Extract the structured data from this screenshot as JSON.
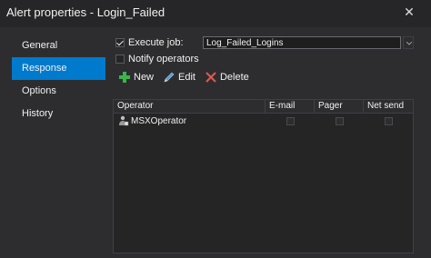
{
  "window": {
    "title": "Alert properties - Login_Failed",
    "close_glyph": "✕"
  },
  "nav": {
    "items": [
      {
        "label": "General",
        "active": false
      },
      {
        "label": "Response",
        "active": true
      },
      {
        "label": "Options",
        "active": false
      },
      {
        "label": "History",
        "active": false
      }
    ]
  },
  "response": {
    "execute_job_label": "Execute job:",
    "execute_job_checked": true,
    "job_value": "Log_Failed_Logins",
    "notify_operators_label": "Notify operators",
    "notify_operators_checked": false
  },
  "toolbar": {
    "new_label": "New",
    "edit_label": "Edit",
    "delete_label": "Delete"
  },
  "grid": {
    "columns": [
      "Operator",
      "E-mail",
      "Pager",
      "Net send"
    ],
    "rows": [
      {
        "operator": "MSXOperator",
        "email": false,
        "pager": false,
        "net_send": false
      }
    ]
  },
  "colors": {
    "accent": "#007acc",
    "background": "#2d2d30",
    "new_icon": "#3bb44a",
    "delete_icon": "#e05a4f"
  },
  "icons": {
    "new": "plus-icon",
    "edit": "pencil-icon",
    "delete": "x-icon",
    "operator": "operator-icon"
  }
}
